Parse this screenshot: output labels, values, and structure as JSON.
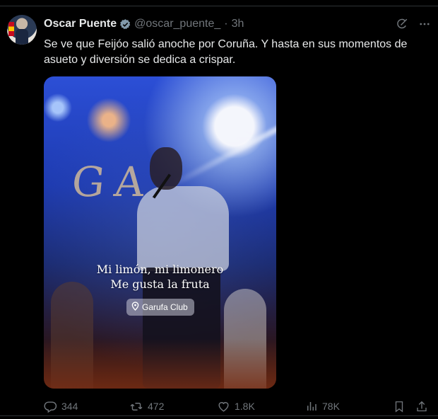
{
  "post": {
    "author_name": "Oscar Puente",
    "handle": "@oscar_puente_",
    "separator": "·",
    "time": "3h",
    "text": "Se ve que Feijóo salió anoche por Coruña. Y hasta en sus momentos de asueto y diversión se dedica a crispar.",
    "media": {
      "lyric_line_1": "Mi limón, mi limonero",
      "lyric_line_2": "Me gusta la fruta",
      "location_label": "Garufa Club",
      "sign_letters": "GA"
    },
    "stats": {
      "replies": "344",
      "reposts": "472",
      "likes": "1.8K",
      "views": "78K"
    }
  },
  "icons": {
    "verified": "verified-badge-icon",
    "grok": "grok-icon",
    "more": "more-icon",
    "reply": "reply-icon",
    "repost": "repost-icon",
    "like": "heart-icon",
    "views": "views-icon",
    "bookmark": "bookmark-icon",
    "share": "share-icon",
    "location": "location-pin-icon"
  },
  "colors": {
    "background": "#000000",
    "text": "#e7e9ea",
    "secondary": "#71767b",
    "border": "#2f3336"
  }
}
